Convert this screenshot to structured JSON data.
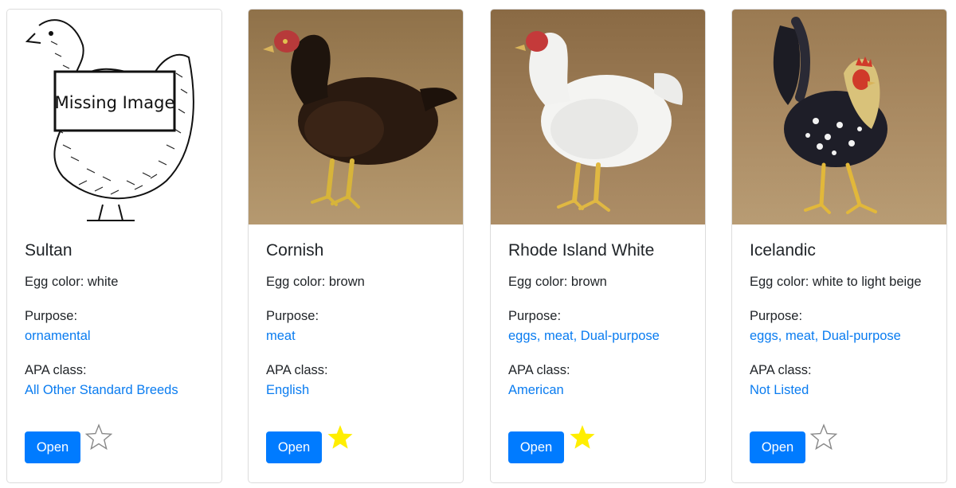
{
  "cards": [
    {
      "name": "Sultan",
      "egg": "Egg color: white",
      "purpose_label": "Purpose:",
      "purpose": "ornamental",
      "apa_label": "APA class:",
      "apa": "All Other Standard Breeds",
      "open": "Open",
      "favorite": false,
      "image": "missing-image-placeholder",
      "missing_image_text": "Missing Image"
    },
    {
      "name": "Cornish",
      "egg": "Egg color: brown",
      "purpose_label": "Purpose:",
      "purpose": "meat",
      "apa_label": "APA class:",
      "apa": "English",
      "open": "Open",
      "favorite": true,
      "image": "dark-hen-photo"
    },
    {
      "name": "Rhode Island White",
      "egg": "Egg color: brown",
      "purpose_label": "Purpose:",
      "purpose": "eggs, meat, Dual-purpose",
      "apa_label": "APA class:",
      "apa": "American",
      "open": "Open",
      "favorite": true,
      "image": "white-hen-photo"
    },
    {
      "name": "Icelandic",
      "egg": "Egg color: white to light beige",
      "purpose_label": "Purpose:",
      "purpose": "eggs, meat, Dual-purpose",
      "apa_label": "APA class:",
      "apa": "Not Listed",
      "open": "Open",
      "favorite": false,
      "image": "speckled-rooster-photo"
    }
  ],
  "colors": {
    "link": "#0a7cf0",
    "button": "#007bff",
    "star_filled": "#ffee00",
    "star_outline": "#888888",
    "photo_background": "#a08158"
  }
}
